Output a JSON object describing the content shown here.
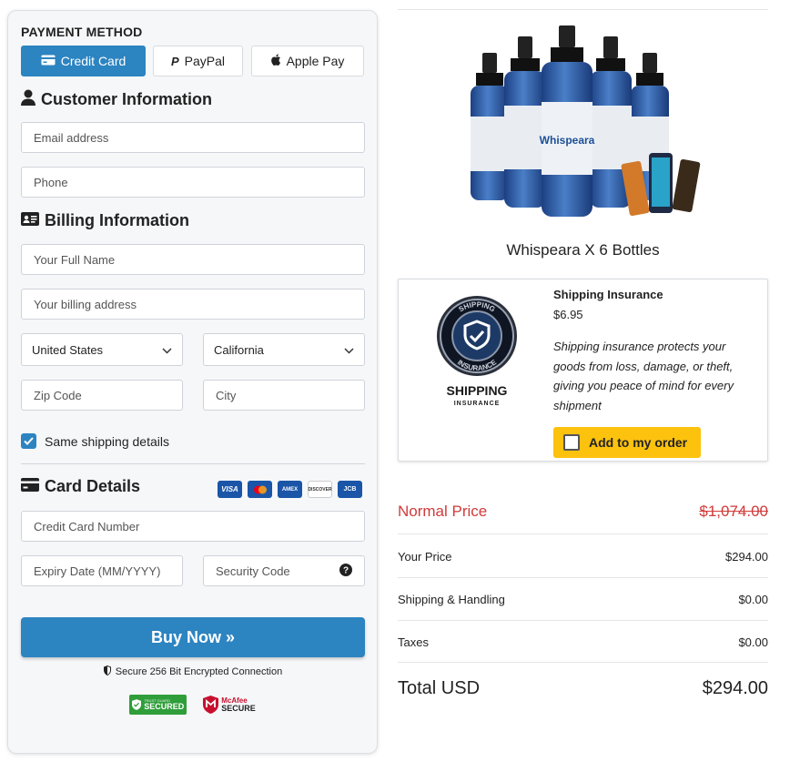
{
  "payment": {
    "section_title": "PAYMENT METHOD",
    "methods": [
      {
        "label": "Credit Card",
        "icon": "credit-card-icon",
        "active": true
      },
      {
        "label": "PayPal",
        "icon": "paypal-icon",
        "active": false
      },
      {
        "label": "Apple Pay",
        "icon": "apple-icon",
        "active": false
      }
    ]
  },
  "customer": {
    "title": "Customer Information",
    "email_placeholder": "Email address",
    "phone_placeholder": "Phone"
  },
  "billing": {
    "title": "Billing Information",
    "name_placeholder": "Your Full Name",
    "address_placeholder": "Your billing address",
    "country": "United States",
    "state": "California",
    "zip_placeholder": "Zip Code",
    "city_placeholder": "City",
    "same_shipping_label": "Same shipping details",
    "same_shipping_checked": true
  },
  "card": {
    "title": "Card Details",
    "brands": [
      {
        "name": "VISA",
        "color": "#1a55a8"
      },
      {
        "name": "mastercard",
        "color": "#1a55a8"
      },
      {
        "name": "AMEX",
        "color": "#1a55a8"
      },
      {
        "name": "DISCOVER",
        "color": "#ffffff"
      },
      {
        "name": "JCB",
        "color": "#1a55a8"
      }
    ],
    "number_placeholder": "Credit Card Number",
    "expiry_placeholder": "Expiry Date (MM/YYYY)",
    "cvv_placeholder": "Security Code"
  },
  "checkout": {
    "buy_label": "Buy Now »",
    "secure_text": "Secure 256 Bit Encrypted Connection",
    "badge_secured_small": "TRUST GUARD",
    "badge_secured": "SECURED",
    "badge_mcafee": "McAfee",
    "badge_mcafee_secure": "SECURE"
  },
  "product": {
    "brand_on_bottle": "Whispeara",
    "name": "Whispeara X 6 Bottles"
  },
  "insurance": {
    "logo_top": "SHIPPING",
    "logo_bottom": "INSURANCE",
    "logo_title": "SHIPPING",
    "logo_subtitle": "INSURANCE",
    "title": "Shipping Insurance",
    "price": "$6.95",
    "description": "Shipping insurance protects your goods from loss, damage, or theft, giving you peace of mind for every shipment",
    "add_label": "Add to my order"
  },
  "summary": {
    "normal_label": "Normal Price",
    "normal_value": "$1,074.00",
    "your_price_label": "Your Price",
    "your_price_value": "$294.00",
    "shipping_label": "Shipping & Handling",
    "shipping_value": "$0.00",
    "taxes_label": "Taxes",
    "taxes_value": "$0.00",
    "total_label": "Total USD",
    "total_value": "$294.00"
  },
  "colors": {
    "accent": "#2c84c1",
    "normal_price": "#d23a3a",
    "add_button": "#fcc20e"
  }
}
